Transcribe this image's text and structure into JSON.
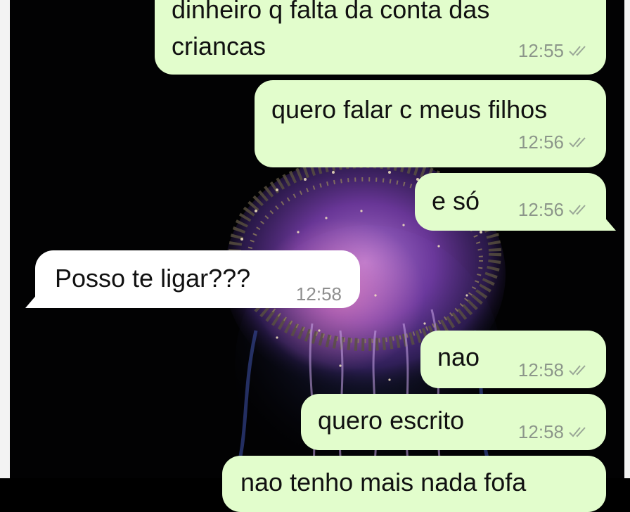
{
  "messages": [
    {
      "direction": "out",
      "text_lines": [
        "dinheiro q falta da conta das",
        "criancas"
      ],
      "time": "12:55",
      "status": "read-ticks-icon"
    },
    {
      "direction": "out",
      "text": "quero falar c meus filhos",
      "time": "12:56",
      "status": "read-ticks-icon"
    },
    {
      "direction": "out",
      "text": "e só",
      "time": "12:56",
      "status": "read-ticks-icon"
    },
    {
      "direction": "in",
      "text": "Posso te ligar???",
      "time": "12:58"
    },
    {
      "direction": "out",
      "text": "nao",
      "time": "12:58",
      "status": "read-ticks-icon"
    },
    {
      "direction": "out",
      "text": "quero escrito",
      "time": "12:58",
      "status": "read-ticks-icon"
    },
    {
      "direction": "out",
      "text": "nao tenho mais nada fofa",
      "time": "",
      "status": ""
    }
  ],
  "colors": {
    "outgoing_bubble": "#e2fdcc",
    "incoming_bubble": "#ffffff",
    "wallpaper": "#020203",
    "tick": "#9aa797"
  },
  "wallpaper_icon": "jellyfish-image"
}
